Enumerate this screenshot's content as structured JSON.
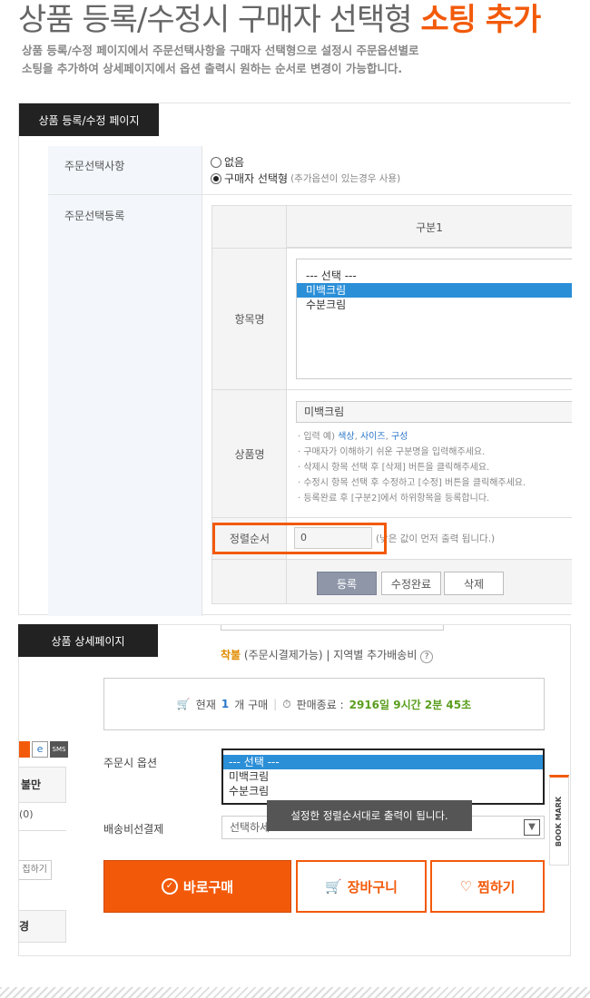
{
  "headline": {
    "main": "상품 등록/수정시 구매자 선택형 ",
    "accent": "소팅 추가"
  },
  "subtext": {
    "line1": "상품 등록/수정 페이지에서 주문선택사항을 구매자 선택형으로 설정시 주문옵션별로",
    "line2": "소팅을 추가하여 상세페이지에서 옵션 출력시 원하는 순서로 변경이 가능합니다."
  },
  "panel1": {
    "tag": "상품 등록/수정 페이지",
    "order_option_label": "주문선택사항",
    "radio_none": "없음",
    "radio_buyer": "구매자 선택형",
    "radio_buyer_note": "(추가옵션이 있는경우 사용)",
    "order_register_label": "주문선택등록",
    "column_header": "구분1",
    "item_name_label": "항목명",
    "list_items": [
      "--- 선택 ---",
      "미백크림",
      "수분크림"
    ],
    "product_name_label": "상품명",
    "product_name_value": "미백크림",
    "notes": {
      "n1_prefix": "· 입력 예) ",
      "n1_ex1": "색상",
      "n1_ex2": "사이즈",
      "n1_ex3": "구성",
      "n2": "· 구매자가 이해하기 쉬운 구분명을 입력해주세요.",
      "n3": "· 삭제시 항목 선택 후 [삭제] 버튼을 클릭해주세요.",
      "n4": "· 수정시 항목 선택 후 수정하고 [수정] 버튼을 클릭해주세요.",
      "n5": "· 등록완료 후 [구분2]에서 하위항목을 등록합니다."
    },
    "sort_order_label": "정렬순서",
    "sort_order_value": "0",
    "sort_order_note": "(낮은 값이 먼저 출력 됩니다.)",
    "btn_register": "등록",
    "btn_edit_done": "수정완료",
    "btn_delete": "삭제"
  },
  "panel2": {
    "tag": "상품 상세페이지",
    "shipping_prefix": "착불",
    "shipping_text": " (주문시결제가능) | 지역별 추가배송비",
    "help": "?",
    "cart_now": "현재",
    "cart_qty": "1",
    "cart_unit": "개 구매",
    "sale_end_label": "판매종료 :",
    "sale_end_value": "2916일 9시간 2분 45초",
    "option_label": "주문시 옵션",
    "option_items": [
      "--- 선택 ---",
      "미백크림",
      "수분크림"
    ],
    "tooltip": "설정한 정렬순서대로 출력이 됩니다.",
    "shipping_select_label": "배송비선결제",
    "shipping_select_value": "선택하세요",
    "left_bits": {
      "sms": "SMS",
      "dissatisfied": "불만",
      "count": "(0)",
      "close": "집하기",
      "other": "경"
    },
    "btn_buy": "바로구매",
    "btn_cart": "장바구니",
    "btn_wish": "찜하기",
    "bookmark": "BOOK MARK"
  },
  "colors": {
    "accent": "#f25a0a",
    "select_blue": "#2b8fd8",
    "green": "#5a9e1f"
  }
}
